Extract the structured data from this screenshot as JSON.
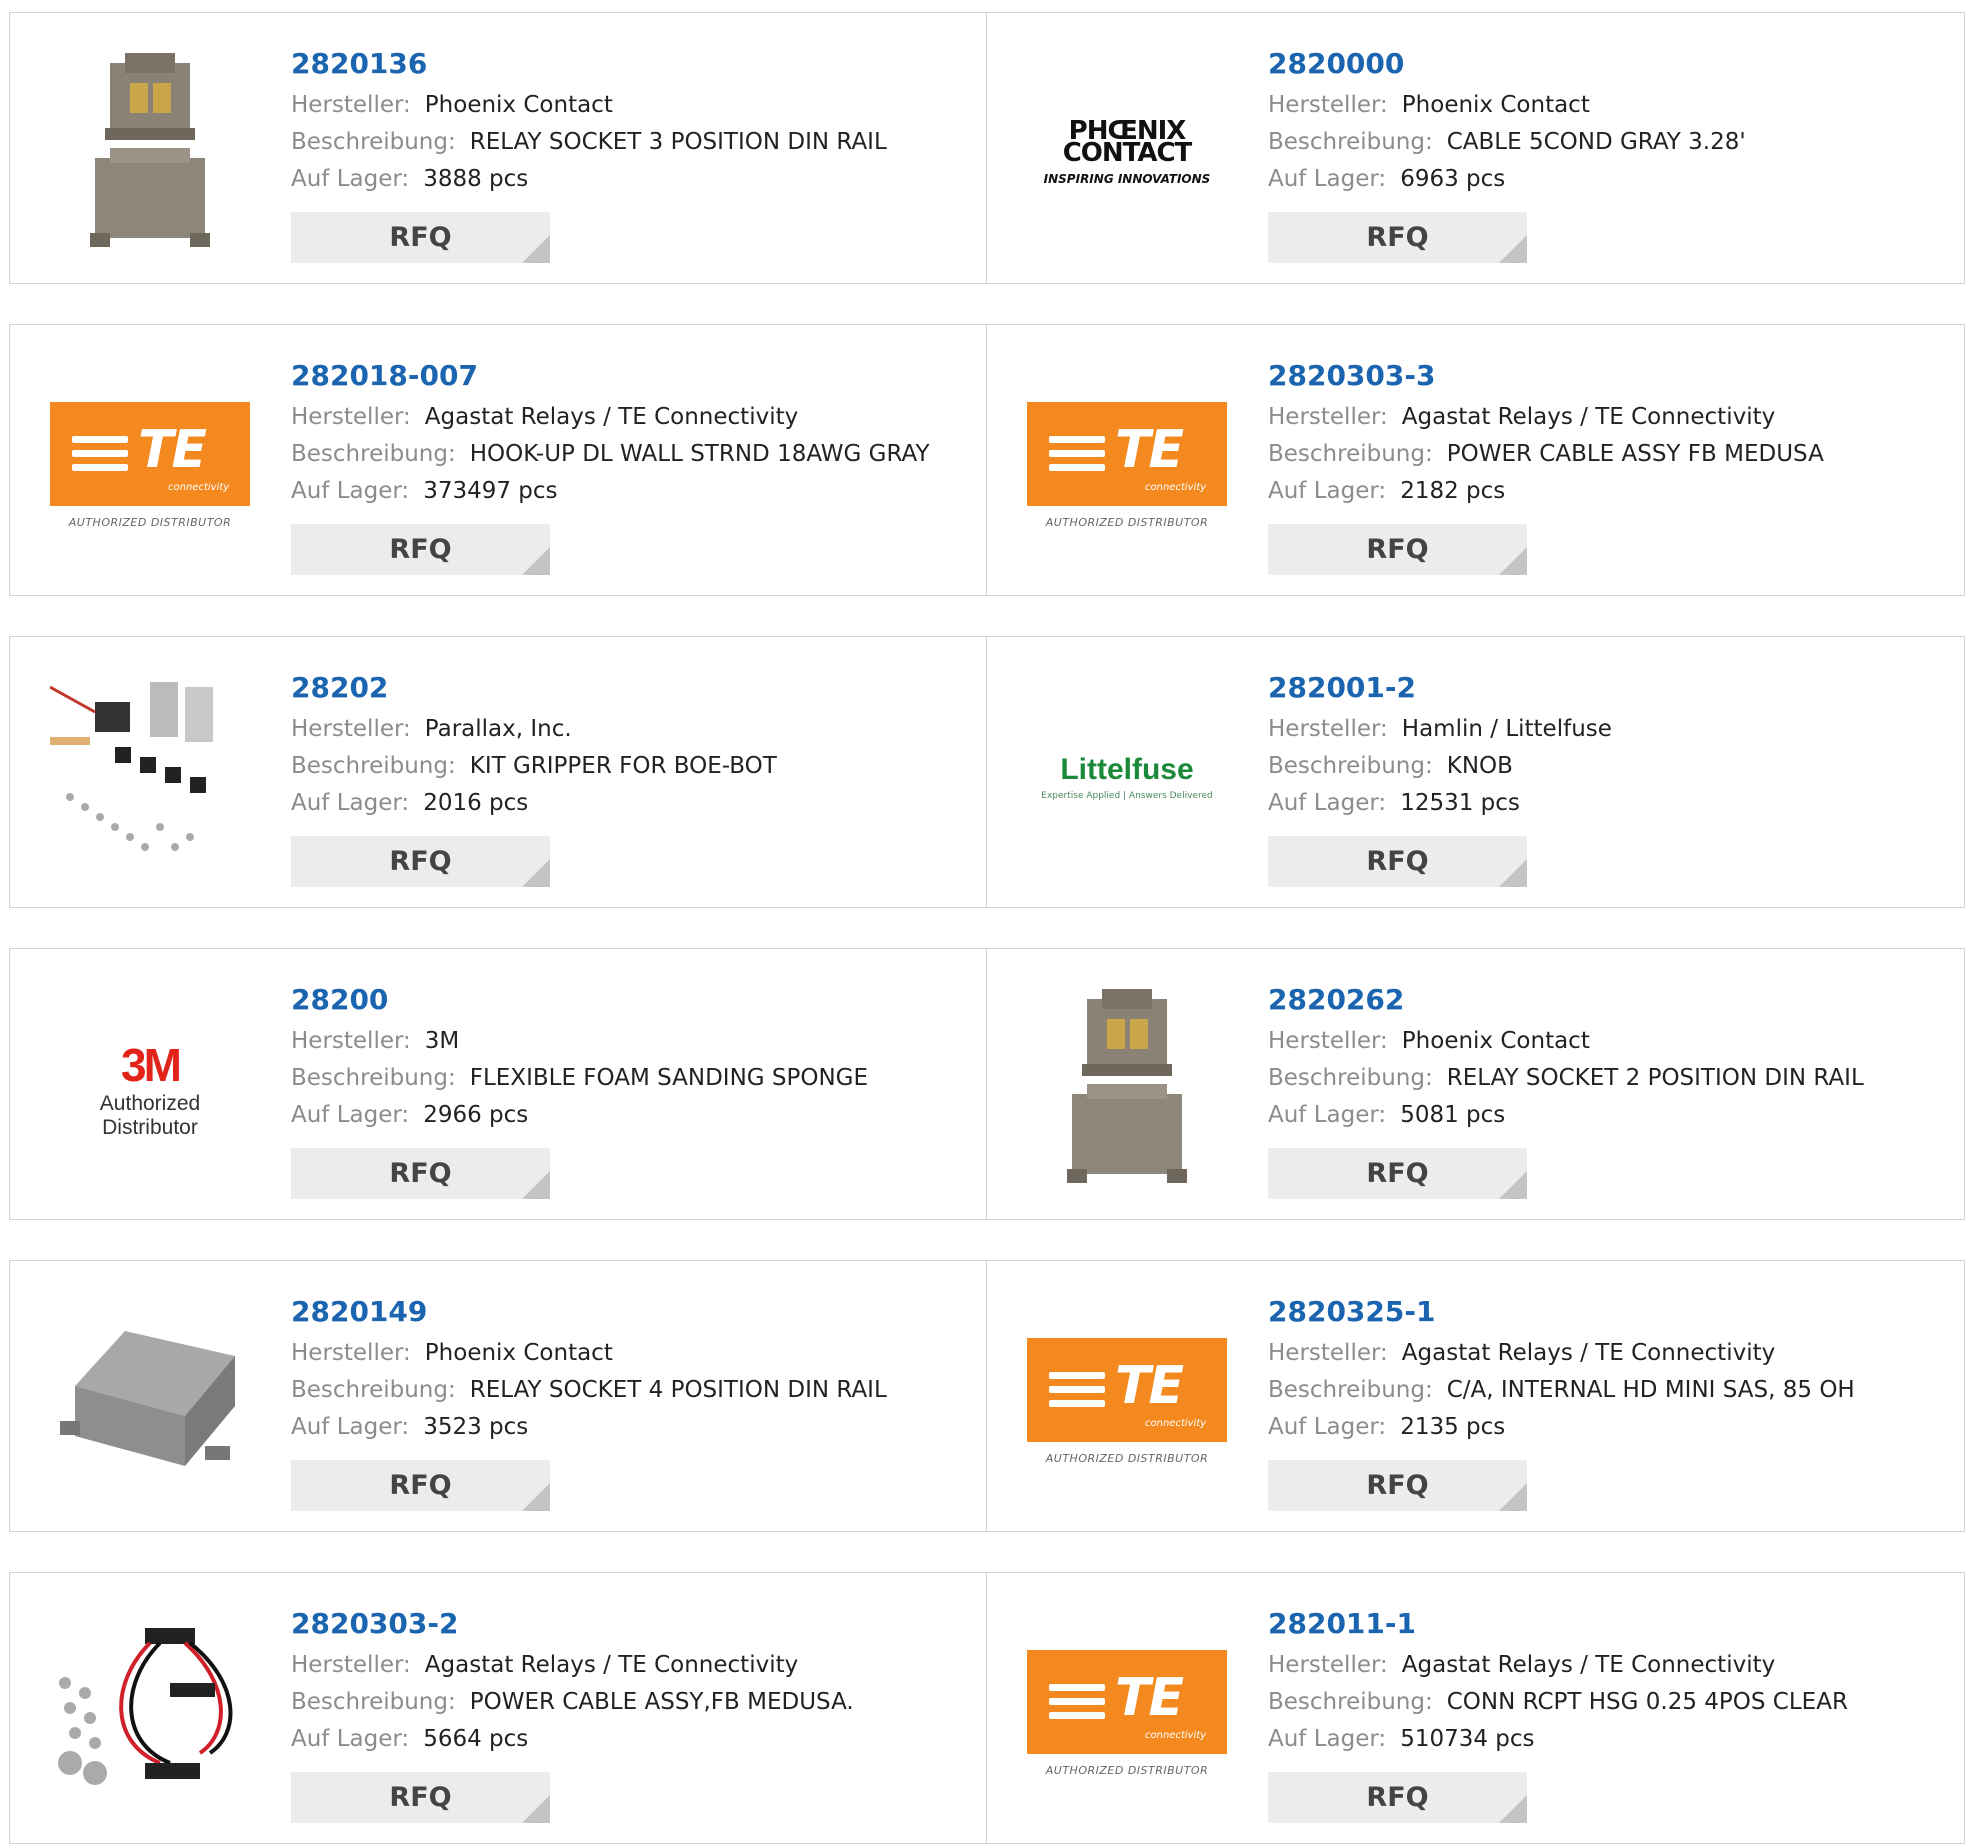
{
  "labels": {
    "manufacturer": "Hersteller:",
    "description": "Beschreibung:",
    "stock": "Auf Lager:",
    "rfq": "RFQ"
  },
  "logos": {
    "te_text": "TE",
    "te_sub": "connectivity",
    "te_auth": "AUTHORIZED DISTRIBUTOR",
    "phoenix_main_1": "PHŒNIX",
    "phoenix_main_2": "CONTACT",
    "phoenix_tag": "INSPIRING INNOVATIONS",
    "littelfuse_main": "Littelfuse",
    "littelfuse_tag": "Expertise Applied | Answers Delivered",
    "m3_main": "3M",
    "m3_auth": "Authorized Distributor"
  },
  "colors": {
    "link": "#1a64b0",
    "te_orange": "#f48a1f",
    "m3_red": "#e2231a",
    "littelfuse_green": "#1a8a3a"
  },
  "products": [
    {
      "part": "2820136",
      "manufacturer": "Phoenix Contact",
      "description": "RELAY SOCKET 3 POSITION DIN RAIL",
      "stock": "3888 pcs",
      "image": "relay-socket-photo"
    },
    {
      "part": "2820000",
      "manufacturer": "Phoenix Contact",
      "description": "CABLE 5COND GRAY 3.28'",
      "stock": "6963 pcs",
      "image": "phoenix-contact-logo"
    },
    {
      "part": "282018-007",
      "manufacturer": "Agastat Relays / TE Connectivity",
      "description": "HOOK-UP DL WALL STRND 18AWG GRAY",
      "stock": "373497 pcs",
      "image": "te-connectivity-logo"
    },
    {
      "part": "2820303-3",
      "manufacturer": "Agastat Relays / TE Connectivity",
      "description": "POWER CABLE ASSY FB MEDUSA",
      "stock": "2182 pcs",
      "image": "te-connectivity-logo"
    },
    {
      "part": "28202",
      "manufacturer": "Parallax, Inc.",
      "description": "KIT GRIPPER FOR BOE-BOT",
      "stock": "2016 pcs",
      "image": "gripper-kit-photo"
    },
    {
      "part": "282001-2",
      "manufacturer": "Hamlin / Littelfuse",
      "description": "KNOB",
      "stock": "12531 pcs",
      "image": "littelfuse-logo"
    },
    {
      "part": "28200",
      "manufacturer": "3M",
      "description": "FLEXIBLE FOAM SANDING SPONGE",
      "stock": "2966 pcs",
      "image": "3m-logo"
    },
    {
      "part": "2820262",
      "manufacturer": "Phoenix Contact",
      "description": "RELAY SOCKET 2 POSITION DIN RAIL",
      "stock": "5081 pcs",
      "image": "relay-socket-photo"
    },
    {
      "part": "2820149",
      "manufacturer": "Phoenix Contact",
      "description": "RELAY SOCKET 4 POSITION DIN RAIL",
      "stock": "3523 pcs",
      "image": "relay-socket-4pos-photo"
    },
    {
      "part": "2820325-1",
      "manufacturer": "Agastat Relays / TE Connectivity",
      "description": "C/A, INTERNAL HD MINI SAS, 85 OH",
      "stock": "2135 pcs",
      "image": "te-connectivity-logo"
    },
    {
      "part": "2820303-2",
      "manufacturer": "Agastat Relays / TE Connectivity",
      "description": "POWER CABLE ASSY,FB MEDUSA.",
      "stock": "5664 pcs",
      "image": "power-cable-photo"
    },
    {
      "part": "282011-1",
      "manufacturer": "Agastat Relays / TE Connectivity",
      "description": "CONN RCPT HSG 0.25 4POS CLEAR",
      "stock": "510734 pcs",
      "image": "te-connectivity-logo"
    }
  ]
}
